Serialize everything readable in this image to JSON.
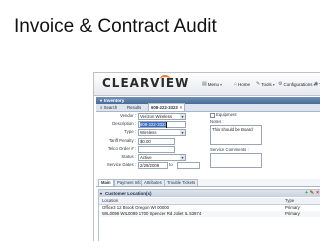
{
  "slide": {
    "title": "Invoice & Contract Audit"
  },
  "app": {
    "logo": "CLEARVIEW",
    "menus": [
      {
        "label": "Menu",
        "icon": "menu-icon"
      },
      {
        "label": "Home",
        "icon": "home-icon"
      },
      {
        "label": "Tools",
        "icon": "tools-icon"
      },
      {
        "label": "Configurations",
        "icon": "gear-icon"
      },
      {
        "label": "Vi",
        "icon": "view-icon"
      }
    ],
    "panel_title": "Inventory",
    "tabs": {
      "search": "Search",
      "results": "Results",
      "record": "608-222-3323"
    },
    "form": {
      "vendor_label": "Vendor :",
      "vendor_value": "Verizon Wireless",
      "description_label": "Description :",
      "description_value": "608-222-3323",
      "type_label": "Type :",
      "type_value": "Wireless",
      "tariff_label": "Tariff Penalty :",
      "tariff_value": "$0.00",
      "telco_label": "Telco Order # :",
      "telco_value": "",
      "status_label": "Status :",
      "status_value": "Active",
      "service_dates_label": "Service Dates :",
      "service_start": "2/29/2008",
      "service_to": "to",
      "service_end": "",
      "equipment_label": "Equipment",
      "notes_label": "Notes :",
      "notes_value": "This should be Board",
      "service_comments_label": "Service Comments :"
    },
    "subtabs": [
      "Main",
      "Payment Info",
      "Attributes",
      "Trouble Tickets"
    ],
    "locations": {
      "title": "Customer Location(s)",
      "col_location": "Location",
      "col_type": "Type",
      "rows": [
        {
          "location": "Office3 12 Brook Oregon WI 00000",
          "type": "Primary"
        },
        {
          "location": "WIL0099 WIL0099 1700 Spencer Rd Joliet IL 53974",
          "type": "Primary"
        }
      ]
    }
  }
}
